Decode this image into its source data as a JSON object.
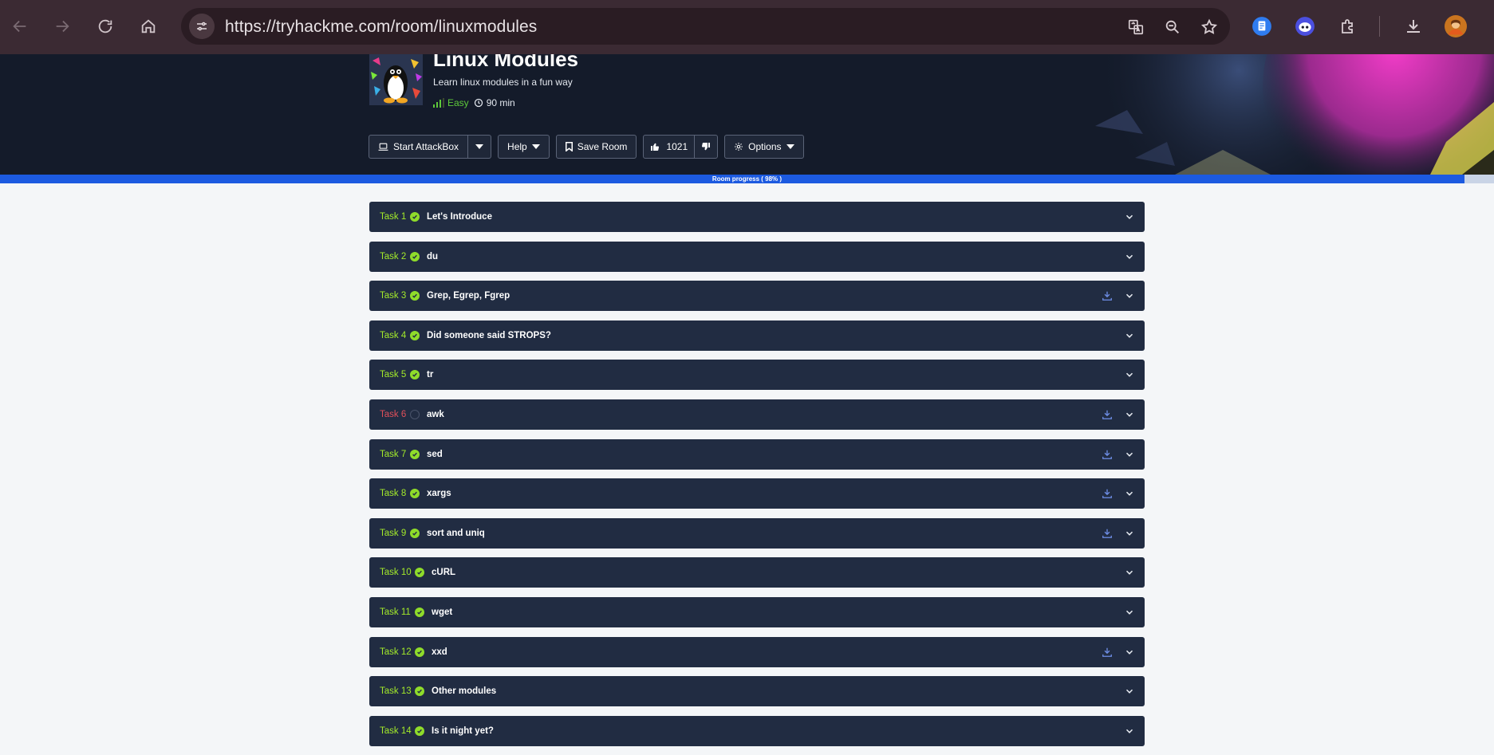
{
  "browser": {
    "url": "https://tryhackme.com/room/linuxmodules"
  },
  "room": {
    "title": "Linux Modules",
    "description": "Learn linux modules in a fun way",
    "difficulty": "Easy",
    "duration": "90 min",
    "buttons": {
      "start_attackbox": "Start AttackBox",
      "help": "Help",
      "save_room": "Save Room",
      "likes": "1021",
      "options": "Options"
    }
  },
  "progress": {
    "label": "Room progress ( 98% )",
    "percent": 98
  },
  "colors": {
    "accent_green": "#a3ea2a",
    "task_bg": "#212c42",
    "incomplete_red": "#e0505a",
    "progress_blue": "#1c5ae0"
  },
  "tasks": [
    {
      "num": "Task 1",
      "title": "Let's Introduce",
      "done": true,
      "download": false
    },
    {
      "num": "Task 2",
      "title": "du",
      "done": true,
      "download": false
    },
    {
      "num": "Task 3",
      "title": "Grep, Egrep, Fgrep",
      "done": true,
      "download": true
    },
    {
      "num": "Task 4",
      "title": "Did someone said STROPS?",
      "done": true,
      "download": false
    },
    {
      "num": "Task 5",
      "title": "tr",
      "done": true,
      "download": false
    },
    {
      "num": "Task 6",
      "title": "awk",
      "done": false,
      "download": true
    },
    {
      "num": "Task 7",
      "title": "sed",
      "done": true,
      "download": true
    },
    {
      "num": "Task 8",
      "title": "xargs",
      "done": true,
      "download": true
    },
    {
      "num": "Task 9",
      "title": "sort and uniq",
      "done": true,
      "download": true
    },
    {
      "num": "Task 10",
      "title": "cURL",
      "done": true,
      "download": false
    },
    {
      "num": "Task 11",
      "title": "wget",
      "done": true,
      "download": false
    },
    {
      "num": "Task 12",
      "title": "xxd",
      "done": true,
      "download": true
    },
    {
      "num": "Task 13",
      "title": "Other modules",
      "done": true,
      "download": false
    },
    {
      "num": "Task 14",
      "title": "Is it night yet?",
      "done": true,
      "download": false
    }
  ]
}
